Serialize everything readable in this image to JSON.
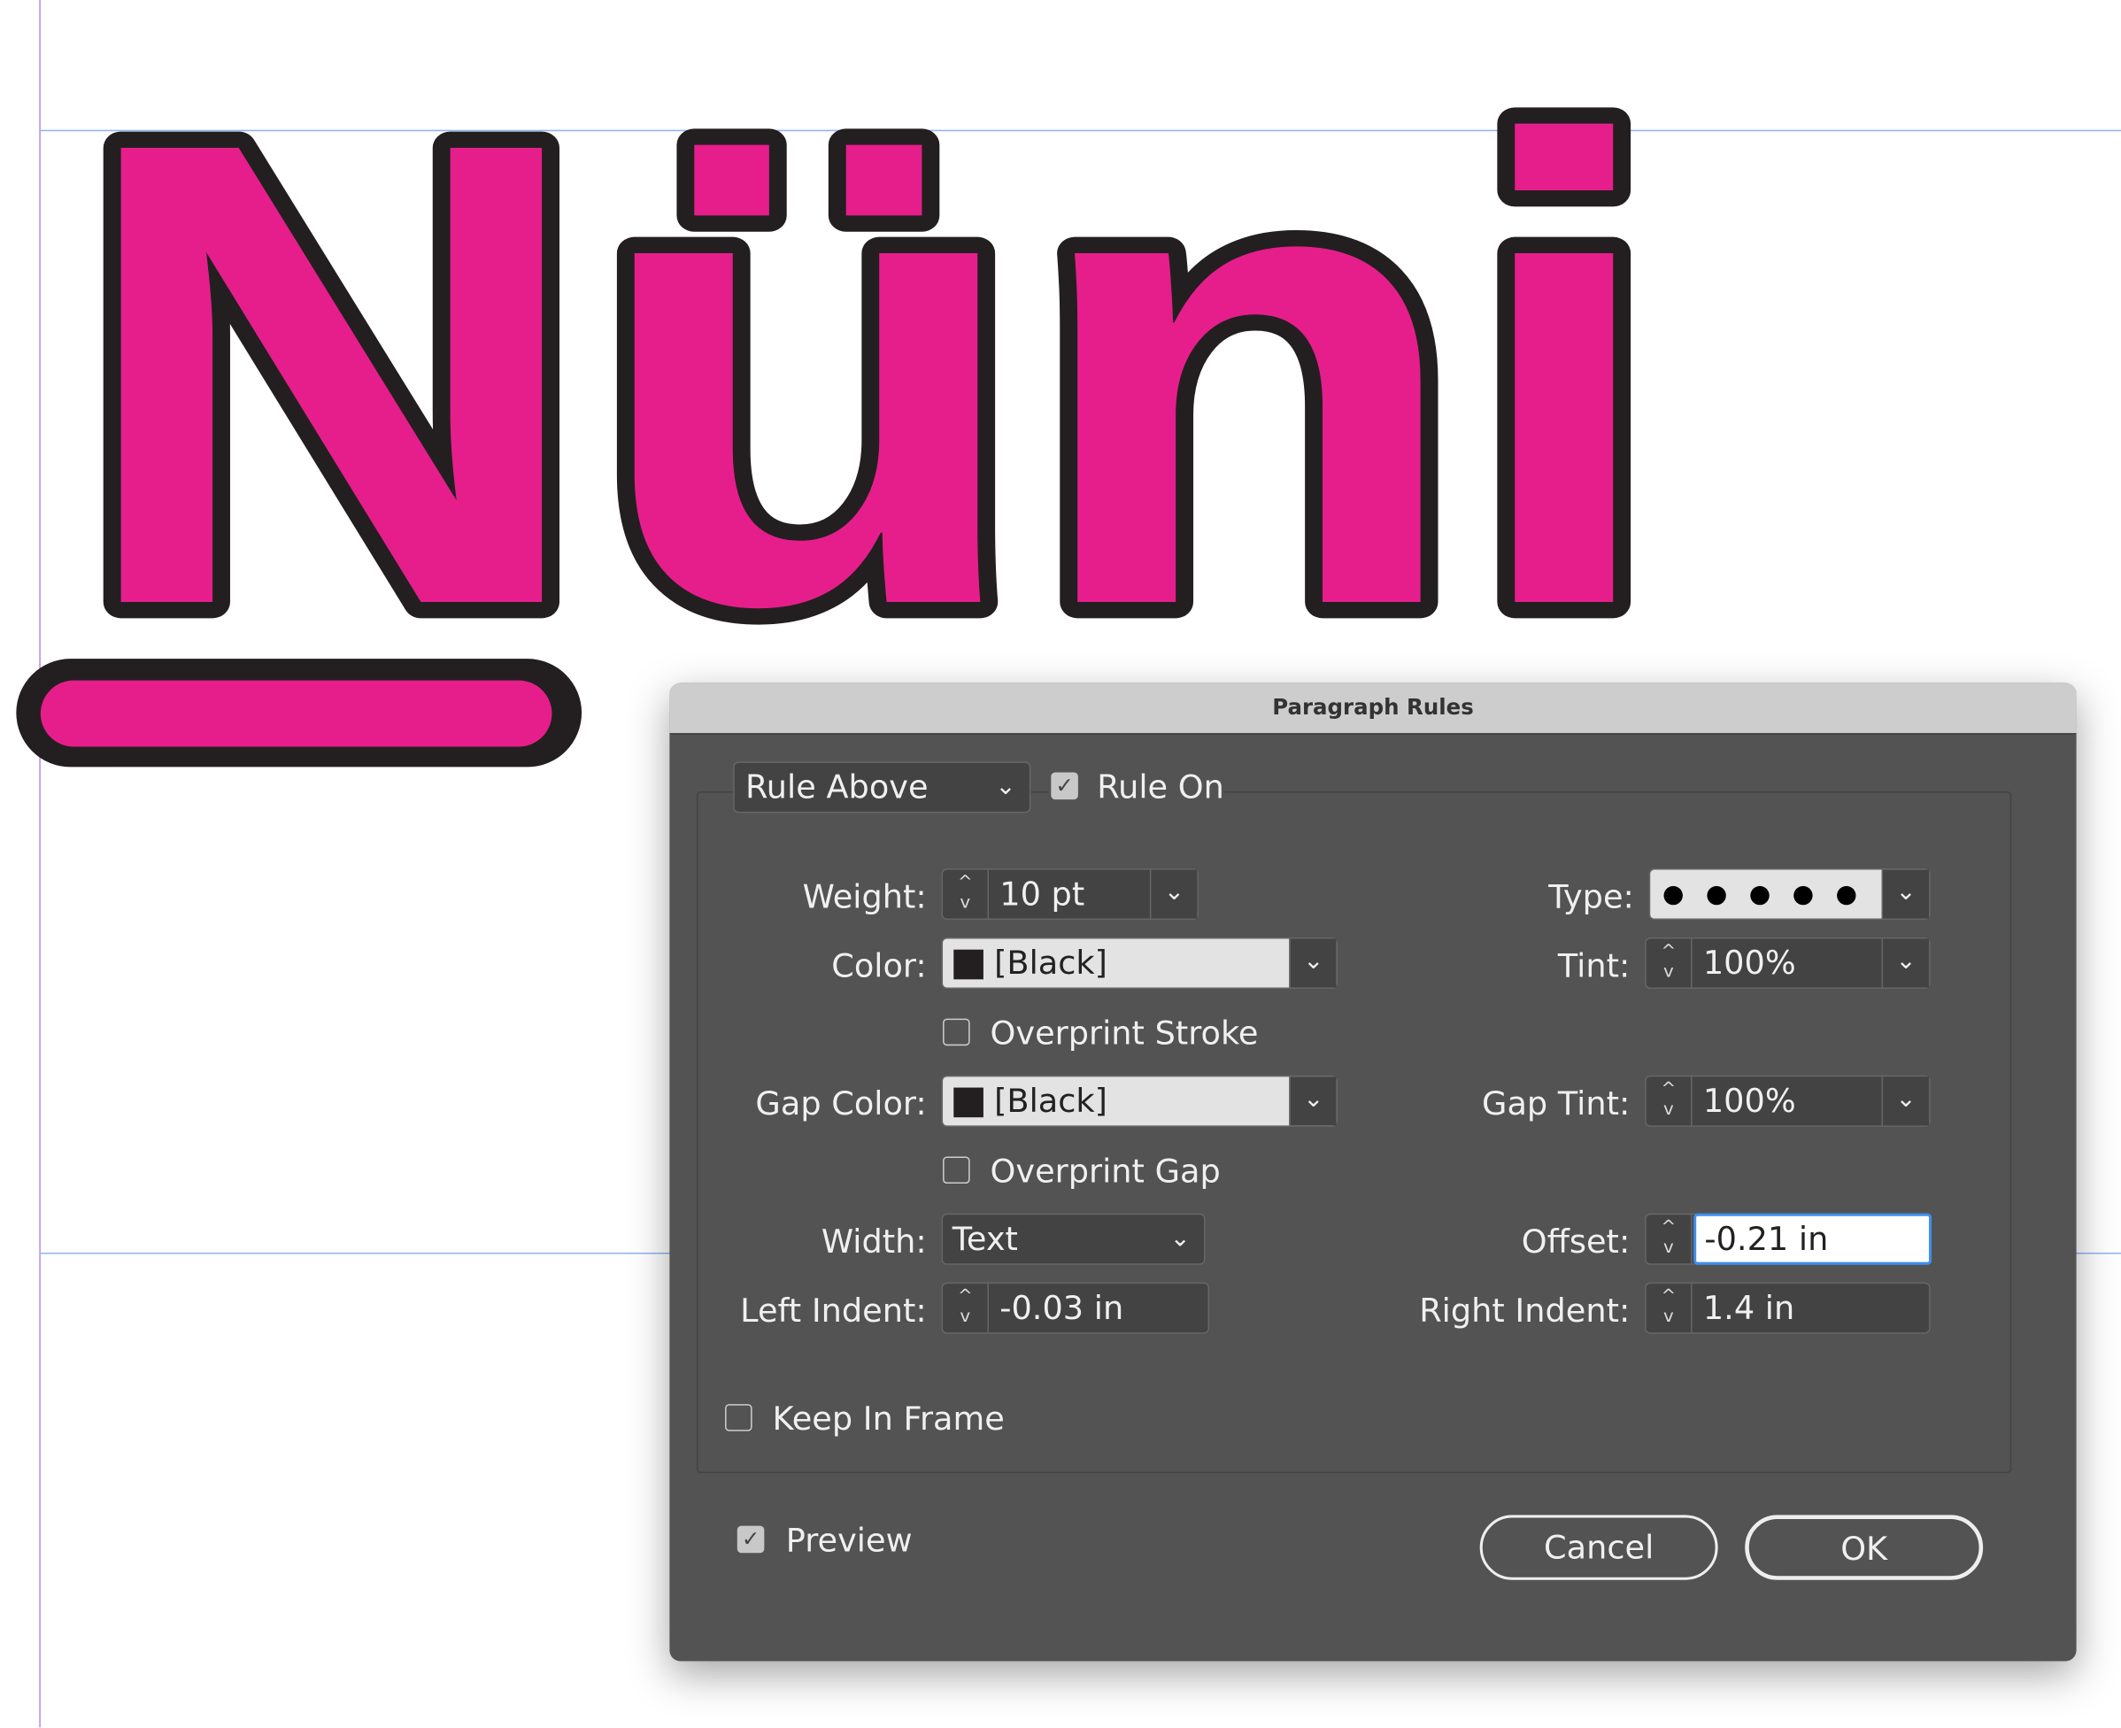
{
  "artwork": {
    "text": "Nüni",
    "fill_color": "#e61e8c",
    "stroke_color": "#231f20"
  },
  "dialog": {
    "title": "Paragraph Rules",
    "rule_select": "Rule Above",
    "rule_on": {
      "label": "Rule On",
      "checked": true
    },
    "weight": {
      "label": "Weight:",
      "value": "10 pt"
    },
    "type": {
      "label": "Type:",
      "value": "dots"
    },
    "color": {
      "label": "Color:",
      "value": "[Black]",
      "swatch": "#231f20"
    },
    "tint": {
      "label": "Tint:",
      "value": "100%"
    },
    "overprint_stroke": {
      "label": "Overprint Stroke",
      "checked": false
    },
    "gap_color": {
      "label": "Gap Color:",
      "value": "[Black]",
      "swatch": "#231f20"
    },
    "gap_tint": {
      "label": "Gap Tint:",
      "value": "100%"
    },
    "overprint_gap": {
      "label": "Overprint Gap",
      "checked": false
    },
    "width": {
      "label": "Width:",
      "value": "Text"
    },
    "offset": {
      "label": "Offset:",
      "value": "-0.21 in"
    },
    "left_indent": {
      "label": "Left Indent:",
      "value": "-0.03 in"
    },
    "right_indent": {
      "label": "Right Indent:",
      "value": "1.4 in"
    },
    "keep_in_frame": {
      "label": "Keep In Frame",
      "checked": false
    },
    "preview": {
      "label": "Preview",
      "checked": true
    },
    "cancel": "Cancel",
    "ok": "OK"
  }
}
